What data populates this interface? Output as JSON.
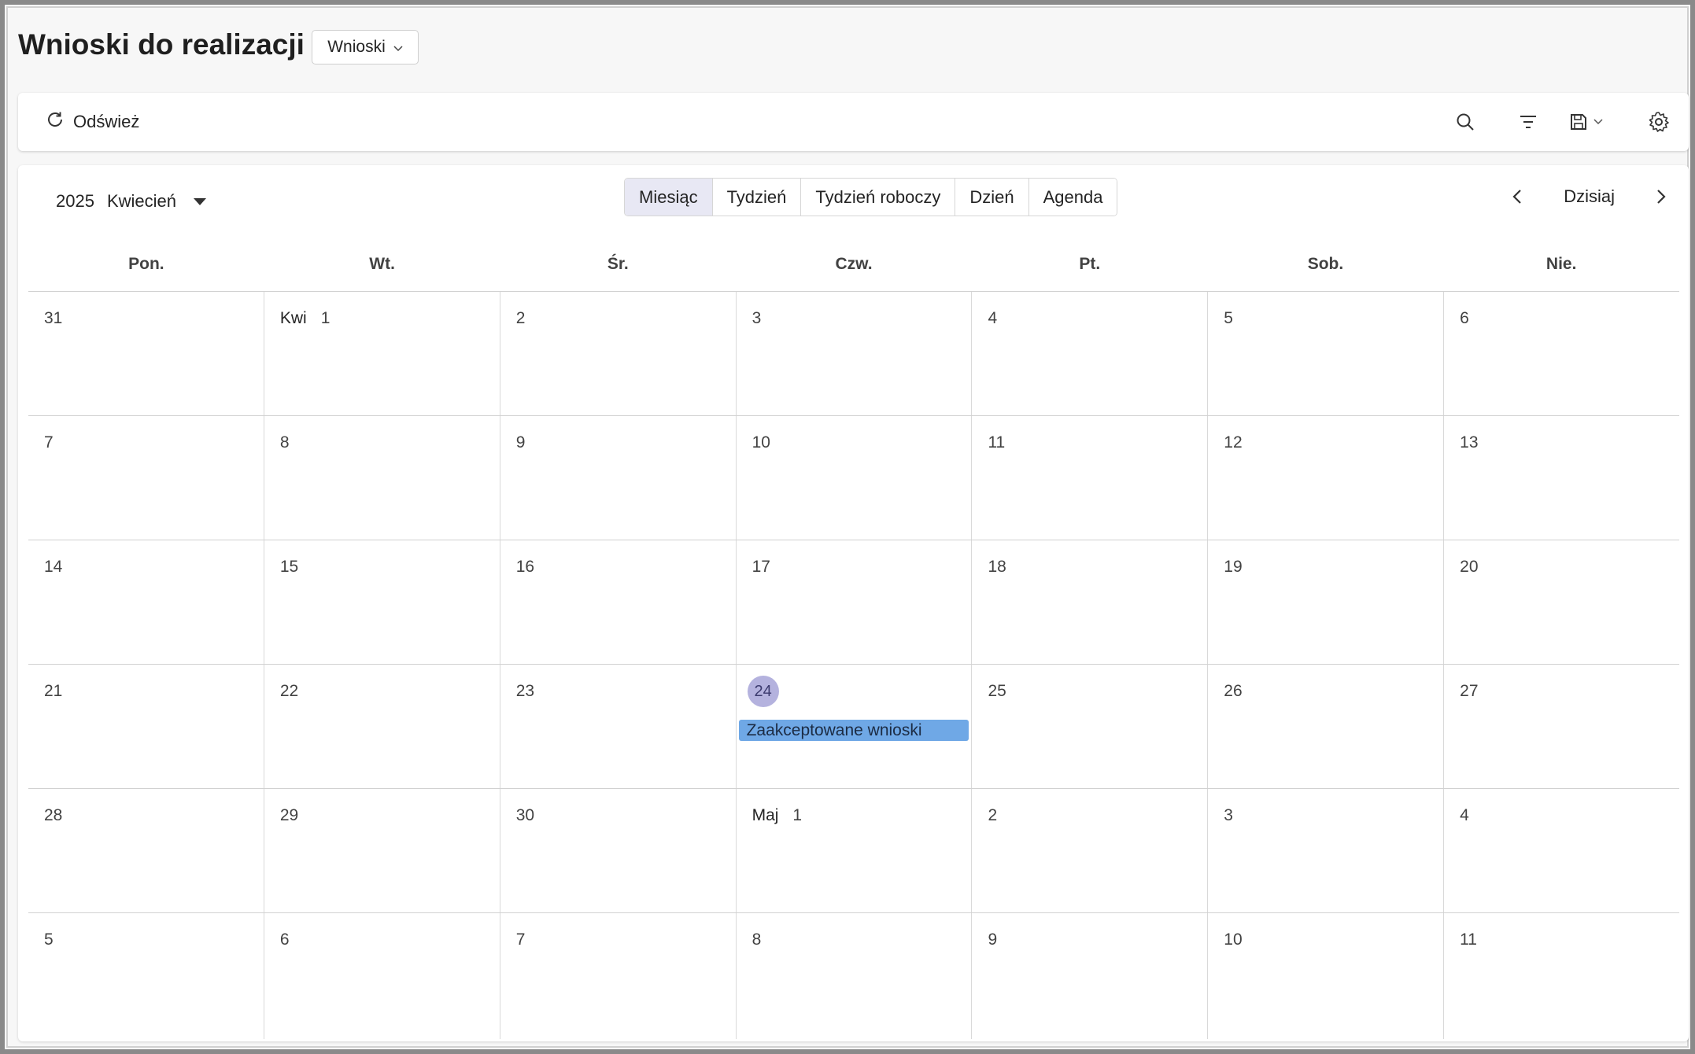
{
  "header": {
    "title": "Wnioski do realizacji",
    "view_selector": "Wnioski"
  },
  "toolbar": {
    "refresh_label": "Odśwież"
  },
  "calendar": {
    "year": "2025",
    "month": "Kwiecień",
    "views": [
      "Miesiąc",
      "Tydzień",
      "Tydzień roboczy",
      "Dzień",
      "Agenda"
    ],
    "active_view": "Miesiąc",
    "today_label": "Dzisiaj",
    "weekdays": [
      "Pon.",
      "Wt.",
      "Śr.",
      "Czw.",
      "Pt.",
      "Sob.",
      "Nie."
    ],
    "weeks": [
      [
        {
          "day": "31"
        },
        {
          "day": "1",
          "month": "Kwi"
        },
        {
          "day": "2"
        },
        {
          "day": "3"
        },
        {
          "day": "4"
        },
        {
          "day": "5"
        },
        {
          "day": "6"
        }
      ],
      [
        {
          "day": "7"
        },
        {
          "day": "8"
        },
        {
          "day": "9"
        },
        {
          "day": "10"
        },
        {
          "day": "11"
        },
        {
          "day": "12"
        },
        {
          "day": "13"
        }
      ],
      [
        {
          "day": "14"
        },
        {
          "day": "15"
        },
        {
          "day": "16"
        },
        {
          "day": "17"
        },
        {
          "day": "18"
        },
        {
          "day": "19"
        },
        {
          "day": "20"
        }
      ],
      [
        {
          "day": "21"
        },
        {
          "day": "22"
        },
        {
          "day": "23"
        },
        {
          "day": "24",
          "today": true,
          "event": "Zaakceptowane wnioski"
        },
        {
          "day": "25"
        },
        {
          "day": "26"
        },
        {
          "day": "27"
        }
      ],
      [
        {
          "day": "28"
        },
        {
          "day": "29"
        },
        {
          "day": "30"
        },
        {
          "day": "1",
          "month": "Maj"
        },
        {
          "day": "2"
        },
        {
          "day": "3"
        },
        {
          "day": "4"
        }
      ],
      [
        {
          "day": "5"
        },
        {
          "day": "6"
        },
        {
          "day": "7"
        },
        {
          "day": "8"
        },
        {
          "day": "9"
        },
        {
          "day": "10"
        },
        {
          "day": "11"
        }
      ]
    ]
  },
  "colors": {
    "accent": "#b4b2de",
    "event": "#6fa8e6",
    "active_tab": "#e8e8f4"
  }
}
